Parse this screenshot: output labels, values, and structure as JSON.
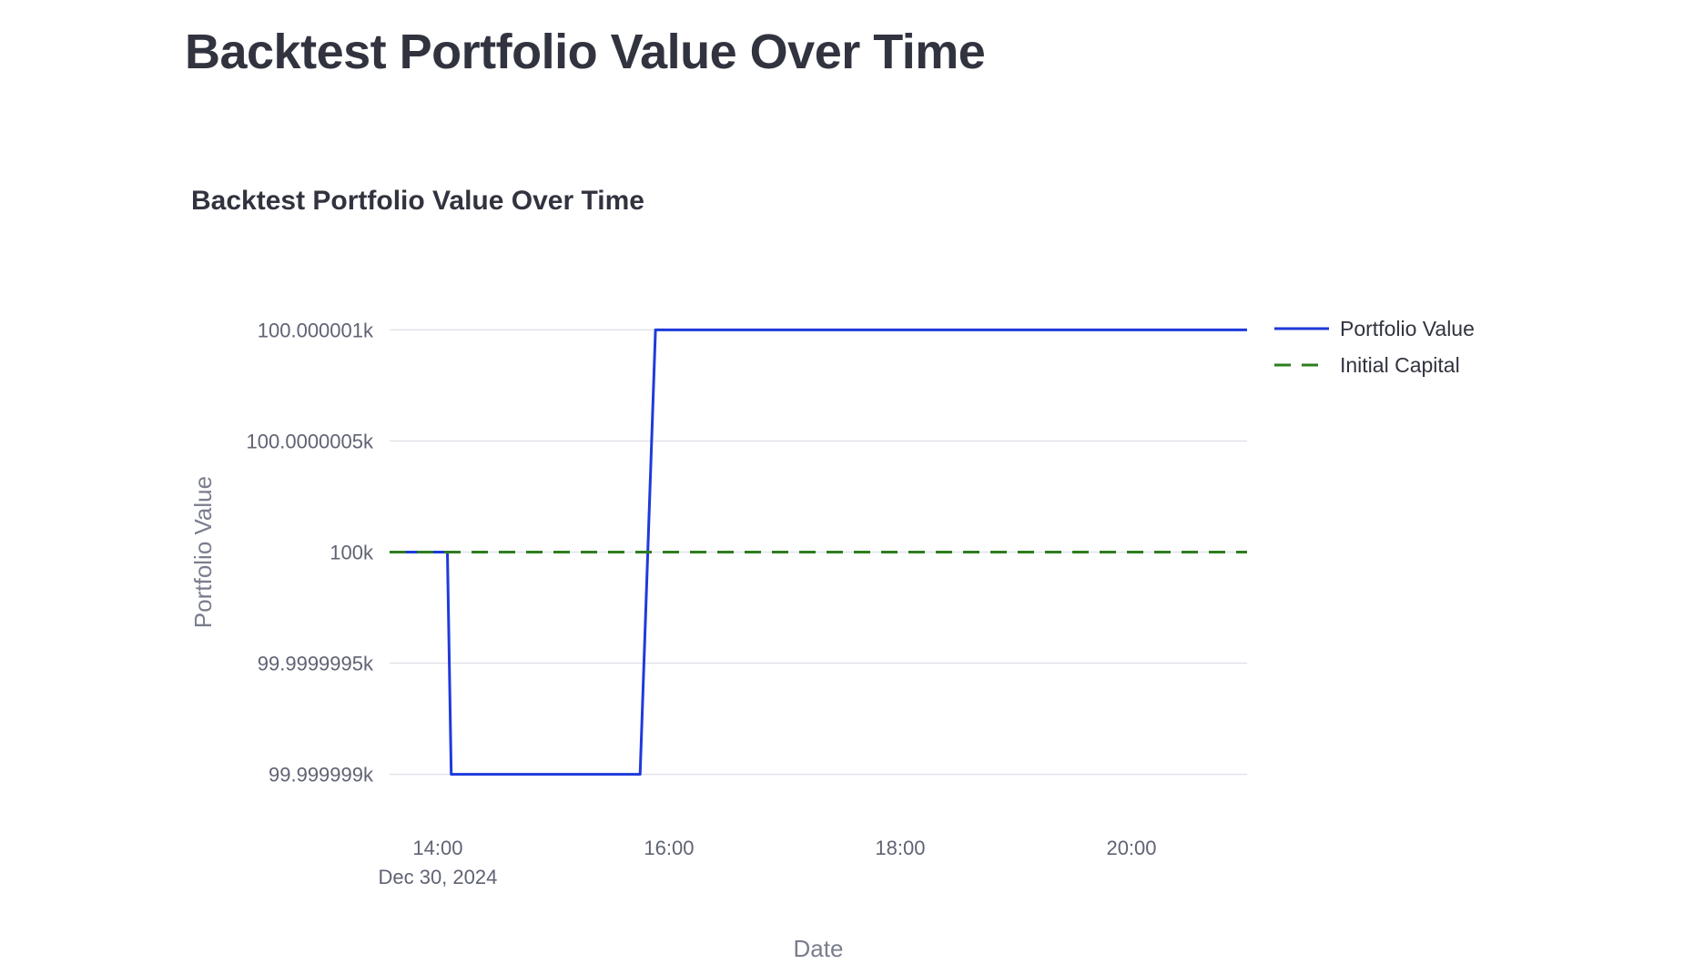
{
  "page": {
    "title": "Backtest Portfolio Value Over Time"
  },
  "chart_data": {
    "type": "line",
    "title": "Backtest Portfolio Value Over Time",
    "xlabel": "Date",
    "ylabel": "Portfolio Value",
    "x_date_label": "Dec 30, 2024",
    "xlim": [
      "2024-12-30T13:35",
      "2024-12-30T21:00"
    ],
    "x_ticks": [
      {
        "value": "2024-12-30T14:00",
        "label": "14:00"
      },
      {
        "value": "2024-12-30T16:00",
        "label": "16:00"
      },
      {
        "value": "2024-12-30T18:00",
        "label": "18:00"
      },
      {
        "value": "2024-12-30T20:00",
        "label": "20:00"
      }
    ],
    "ylim": [
      99999.9989,
      100000.0011
    ],
    "y_ticks": [
      {
        "value": 100000.001,
        "label": "100.000001k"
      },
      {
        "value": 100000.0005,
        "label": "100.0000005k"
      },
      {
        "value": 100000,
        "label": "100k"
      },
      {
        "value": 99999.9995,
        "label": "99.9999995k"
      },
      {
        "value": 99999.999,
        "label": "99.999999k"
      }
    ],
    "grid": true,
    "legend_position": "top-right",
    "series": [
      {
        "name": "Portfolio Value",
        "color": "#1f3adb",
        "dash": "solid",
        "x": [
          "2024-12-30T13:35",
          "2024-12-30T14:05",
          "2024-12-30T14:07",
          "2024-12-30T15:45",
          "2024-12-30T15:53",
          "2024-12-30T21:00"
        ],
        "y": [
          100000,
          100000,
          99999.999,
          99999.999,
          100000.001,
          100000.001
        ]
      },
      {
        "name": "Initial Capital",
        "color": "#2e7d1f",
        "dash": "dashed",
        "x": [
          "2024-12-30T13:35",
          "2024-12-30T21:00"
        ],
        "y": [
          100000,
          100000
        ]
      }
    ]
  }
}
